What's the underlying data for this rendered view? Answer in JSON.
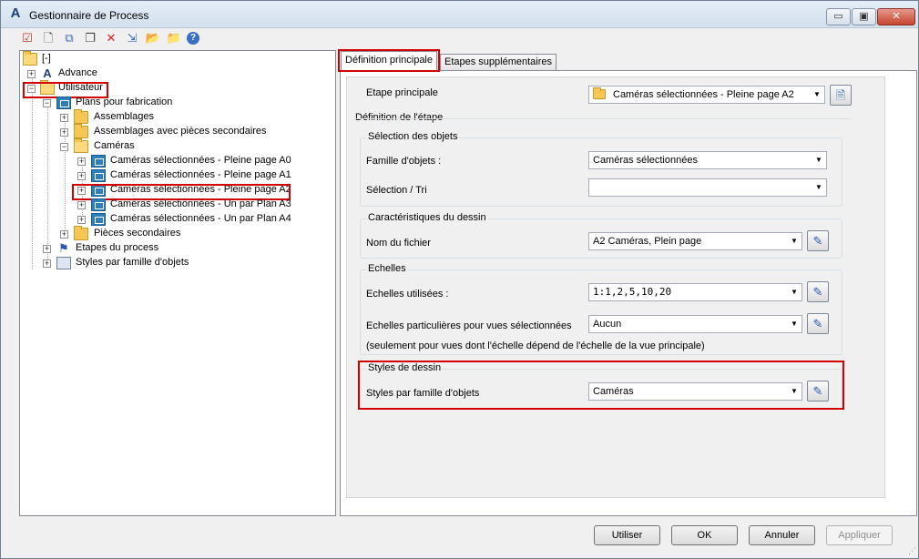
{
  "window": {
    "title": "Gestionnaire de Process",
    "app_icon": "A",
    "controls": {
      "minimize": "▭",
      "maximize": "▣",
      "close": "✕"
    }
  },
  "toolbar": {
    "icons": [
      "check-document-icon",
      "new-document-icon",
      "copy-icon",
      "paste-icon",
      "delete-icon",
      "import-icon",
      "export-folder-icon",
      "folder-settings-icon",
      "help-icon"
    ],
    "glyphs": [
      "☑",
      "🗋",
      "⧉",
      "❐",
      "✕",
      "⇲",
      "📂",
      "📁",
      "?"
    ]
  },
  "tree": {
    "root": "[-]",
    "advance": "Advance",
    "utilisateur": "Utilisateur",
    "plans": "Plans pour fabrication",
    "assemblages": "Assemblages",
    "assemblages_sec": "Assemblages avec pièces secondaires",
    "cameras": "Caméras",
    "cam_a0": "Caméras sélectionnées - Pleine page A0",
    "cam_a1": "Caméras sélectionnées - Pleine page A1",
    "cam_a2": "Caméras sélectionnées - Pleine page A2",
    "cam_a3": "Caméras sélectionnées - Un par Plan A3",
    "cam_a4": "Caméras sélectionnées - Un par Plan A4",
    "pieces": "Pièces secondaires",
    "etapes": "Etapes du process",
    "styles": "Styles par famille d'objets"
  },
  "tabs": {
    "main": "Définition principale",
    "extra": "Etapes supplémentaires"
  },
  "form": {
    "etape_label": "Etape principale",
    "etape_value": "Caméras sélectionnées - Pleine page A2",
    "definition_title": "Définition de l'étape",
    "selection_title": "Sélection des objets",
    "famille_label": "Famille d'objets :",
    "famille_value": "Caméras sélectionnées",
    "tri_label": "Sélection / Tri",
    "tri_value": "",
    "carac_title": "Caractéristiques du dessin",
    "fichier_label": "Nom du fichier",
    "fichier_value": "A2 Caméras, Plein page",
    "echelles_title": "Echelles",
    "echelles_label": "Echelles utilisées :",
    "echelles_value": "1:1,2,5,10,20",
    "part_label": "Echelles particulières pour vues sélectionnées",
    "part_value": "Aucun",
    "part_note": "(seulement pour vues dont l'échelle dépend de l'échelle de la vue principale)",
    "styles_title": "Styles de dessin",
    "styles_label": "Styles par famille d'objets",
    "styles_value": "Caméras"
  },
  "buttons": {
    "utiliser": "Utiliser",
    "ok": "OK",
    "annuler": "Annuler",
    "appliquer": "Appliquer"
  },
  "colors": {
    "highlight": "#d40000",
    "selection_accent": "#2e7fb9"
  }
}
